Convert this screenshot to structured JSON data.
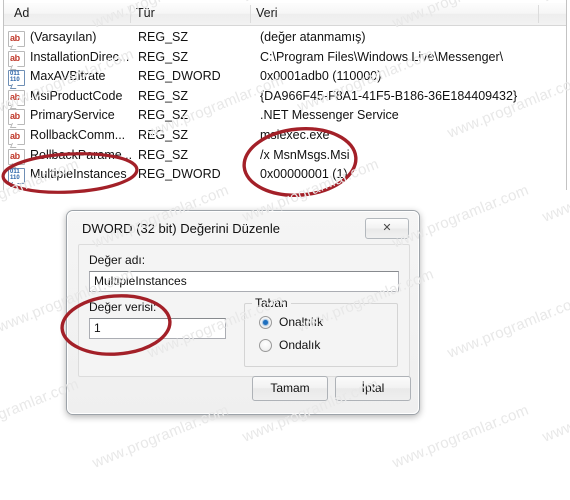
{
  "window": {
    "type": "registry-editor-value-pane"
  },
  "list": {
    "columns": [
      "Ad",
      "Tür",
      "Veri"
    ],
    "rows": [
      {
        "icon": "string-value-icon",
        "name": "(Varsayılan)",
        "type": "REG_SZ",
        "data": "(değer atanmamış)"
      },
      {
        "icon": "string-value-icon",
        "name": "InstallationDirec...",
        "type": "REG_SZ",
        "data": "C:\\Program Files\\Windows Live\\Messenger\\"
      },
      {
        "icon": "dword-value-icon",
        "name": "MaxAVBitrate",
        "type": "REG_DWORD",
        "data": "0x0001adb0 (110000)"
      },
      {
        "icon": "string-value-icon",
        "name": "MsiProductCode",
        "type": "REG_SZ",
        "data": "{DA966F45-F8A1-41F5-B186-36E184409432}"
      },
      {
        "icon": "string-value-icon",
        "name": "PrimaryService",
        "type": "REG_SZ",
        "data": ".NET Messenger Service"
      },
      {
        "icon": "string-value-icon",
        "name": "RollbackComm...",
        "type": "REG_SZ",
        "data": "msiexec.exe"
      },
      {
        "icon": "string-value-icon",
        "name": "RollbackParame...",
        "type": "REG_SZ",
        "data": "/x MsnMsgs.Msi"
      },
      {
        "icon": "dword-value-icon",
        "name": "MultipleInstances",
        "type": "REG_DWORD",
        "data": "0x00000001 (1)"
      }
    ]
  },
  "dialog": {
    "title": "DWORD (32 bit) Değerini Düzenle",
    "close_label": "✕",
    "value_name_label": "Değer adı:",
    "value_name": "MultipleInstances",
    "value_data_label": "Değer verisi:",
    "value_data": "1",
    "base_group_label": "Taban",
    "radios": [
      {
        "label": "Onaltılık",
        "selected": true
      },
      {
        "label": "Ondalık",
        "selected": false
      }
    ],
    "ok_label": "Tamam",
    "cancel_label": "İptal"
  },
  "annotations": {
    "ellipse_count": 3,
    "color": "#a32028",
    "targets": [
      "MultipleInstances",
      "0x00000001 (1)",
      "Değer verisi: 1"
    ]
  },
  "watermark": {
    "text": "www.programlar.com",
    "color": "#e8e8e8"
  }
}
